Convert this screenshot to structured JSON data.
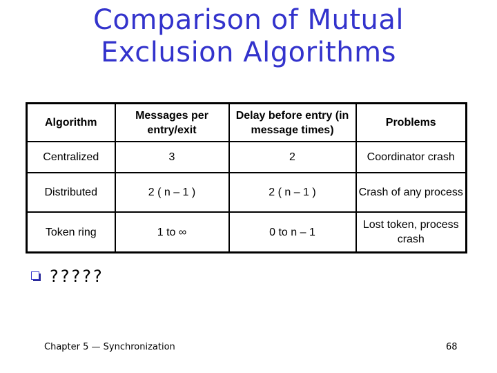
{
  "slide": {
    "title_line1": "Comparison of Mutual",
    "title_line2": "Exclusion Algorithms",
    "accent_color": "#3333cc"
  },
  "table": {
    "headers": {
      "algorithm": "Algorithm",
      "messages": "Messages per entry/exit",
      "delay": "Delay before entry (in message times)",
      "problems": "Problems"
    },
    "rows": [
      {
        "algorithm": "Centralized",
        "messages": "3",
        "delay": "2",
        "problems": "Coordinator crash"
      },
      {
        "algorithm": "Distributed",
        "messages": "2 ( n – 1 )",
        "delay": "2 ( n – 1 )",
        "problems": "Crash of any process"
      },
      {
        "algorithm": "Token ring",
        "messages": "1 to ∞",
        "delay": "0 to n – 1",
        "problems": "Lost token, process crash"
      }
    ]
  },
  "bullet": {
    "icon": "checkbox-square-icon",
    "text": "?????"
  },
  "footer": {
    "chapter": "Chapter 5 — Synchronization",
    "page_number": "68"
  }
}
